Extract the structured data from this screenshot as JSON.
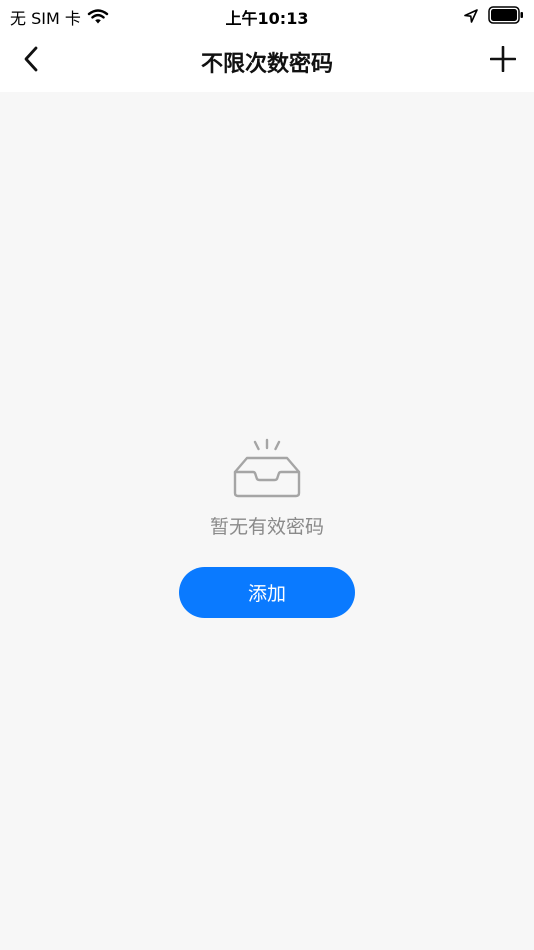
{
  "status_bar": {
    "carrier": "无 SIM 卡",
    "time": "上午10:13",
    "icons": [
      "wifi-icon",
      "location-icon",
      "battery-icon"
    ]
  },
  "nav": {
    "title": "不限次数密码",
    "back_icon": "chevron-left-icon",
    "add_icon": "plus-icon"
  },
  "empty_state": {
    "icon": "empty-tray-icon",
    "message": "暂无有效密码",
    "add_label": "添加"
  },
  "colors": {
    "accent": "#0a7aff",
    "background": "#f7f7f7",
    "muted_text": "#8a8a8a"
  }
}
